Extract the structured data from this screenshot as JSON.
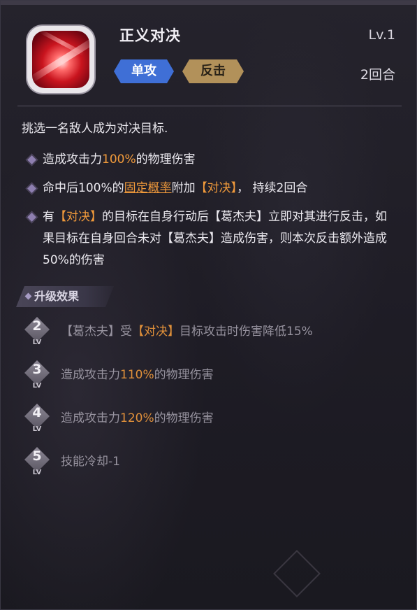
{
  "skill": {
    "name": "正义对决",
    "level": "Lv.1",
    "tags": [
      "单攻",
      "反击"
    ],
    "duration": "2回合",
    "icon": "red-slash-skill-icon"
  },
  "description": {
    "intro": "挑选一名敌人成为对决目标.",
    "bullets": [
      {
        "pre": "造成攻击力",
        "hl": "100%",
        "post": "的物理伤害"
      },
      {
        "pre": "命中后100%的",
        "link": "固定概率",
        "mid": "附加",
        "hl": "【对决】",
        "post": "， 持续2回合"
      },
      {
        "pre": "有",
        "hl": "【对决】",
        "post": "的目标在自身行动后【葛杰夫】立即对其进行反击，如果目标在自身回合未对【葛杰夫】造成伤害，则本次反击额外造成50%的伤害"
      }
    ]
  },
  "upgrades": {
    "header": "升级效果",
    "lv_label": "LV",
    "items": [
      {
        "level": "2",
        "pre": "【葛杰夫】受",
        "hl": "【对决】",
        "post": "目标攻击时伤害降低15%"
      },
      {
        "level": "3",
        "pre": "造成攻击力",
        "hl": "110%",
        "post": "的物理伤害"
      },
      {
        "level": "4",
        "pre": "造成攻击力",
        "hl": "120%",
        "post": "的物理伤害"
      },
      {
        "level": "5",
        "pre": "技能冷却-1",
        "hl": "",
        "post": ""
      }
    ]
  },
  "colors": {
    "highlight": "#f19a3b",
    "tag_blue": "#3f6fd6",
    "tag_gold": "#b2915a"
  }
}
